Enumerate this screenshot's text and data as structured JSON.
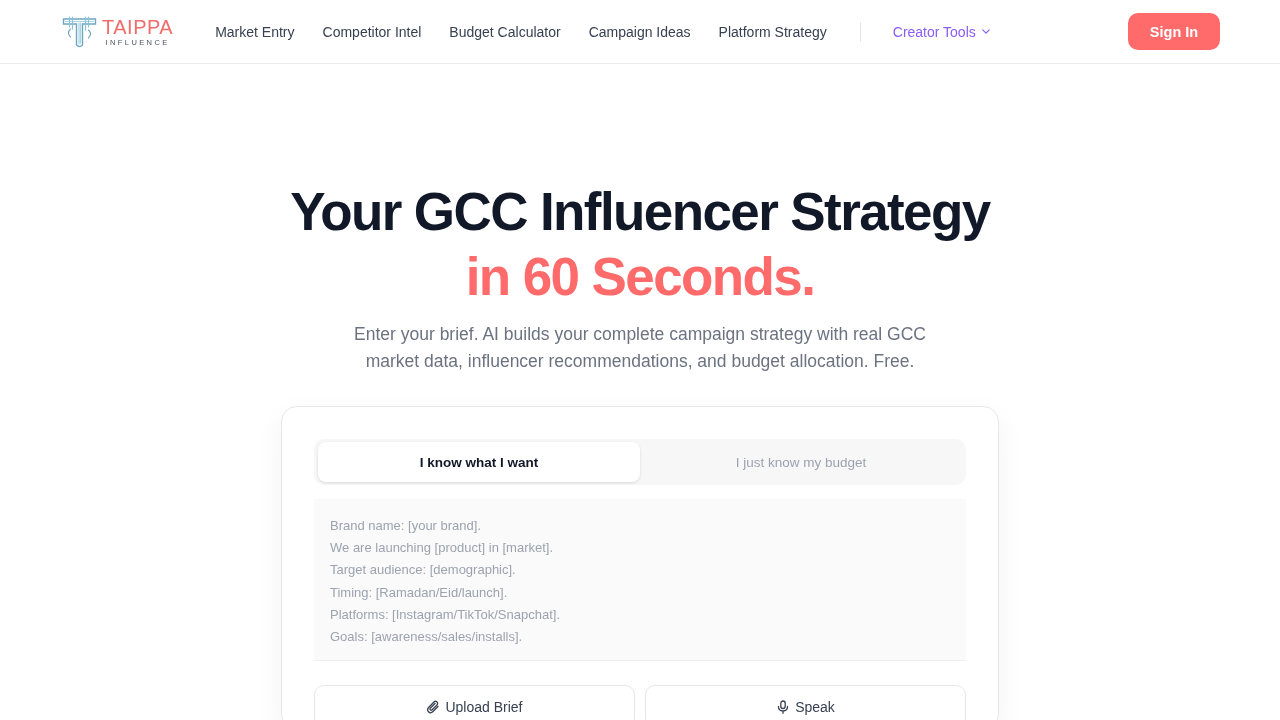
{
  "nav": {
    "logo": {
      "name": "TAIPPA",
      "tagline": "INFLUENCE"
    },
    "links": [
      "Market Entry",
      "Competitor Intel",
      "Budget Calculator",
      "Campaign Ideas",
      "Platform Strategy"
    ],
    "menu": {
      "label": "Creator Tools"
    },
    "sign_in": "Sign In"
  },
  "hero": {
    "title": "Your GCC Influencer Strategy",
    "highlight": "in 60 Seconds.",
    "subtitle": "Enter your brief. AI builds your complete campaign strategy with real GCC market data, influencer recommendations, and budget allocation. Free."
  },
  "brief": {
    "tabs": [
      {
        "label": "I know what I want",
        "selected": true
      },
      {
        "label": "I just know my budget",
        "selected": false
      }
    ],
    "placeholder": "Brand name: [your brand].\nWe are launching [product] in [market].\nTarget audience: [demographic].\nTiming: [Ramadan/Eid/launch].\nPlatforms: [Instagram/TikTok/Snapchat].\nGoals: [awareness/sales/installs].",
    "actions": [
      {
        "kind": "upload",
        "label": "Upload Brief"
      },
      {
        "kind": "speak",
        "label": "Speak"
      }
    ]
  }
}
